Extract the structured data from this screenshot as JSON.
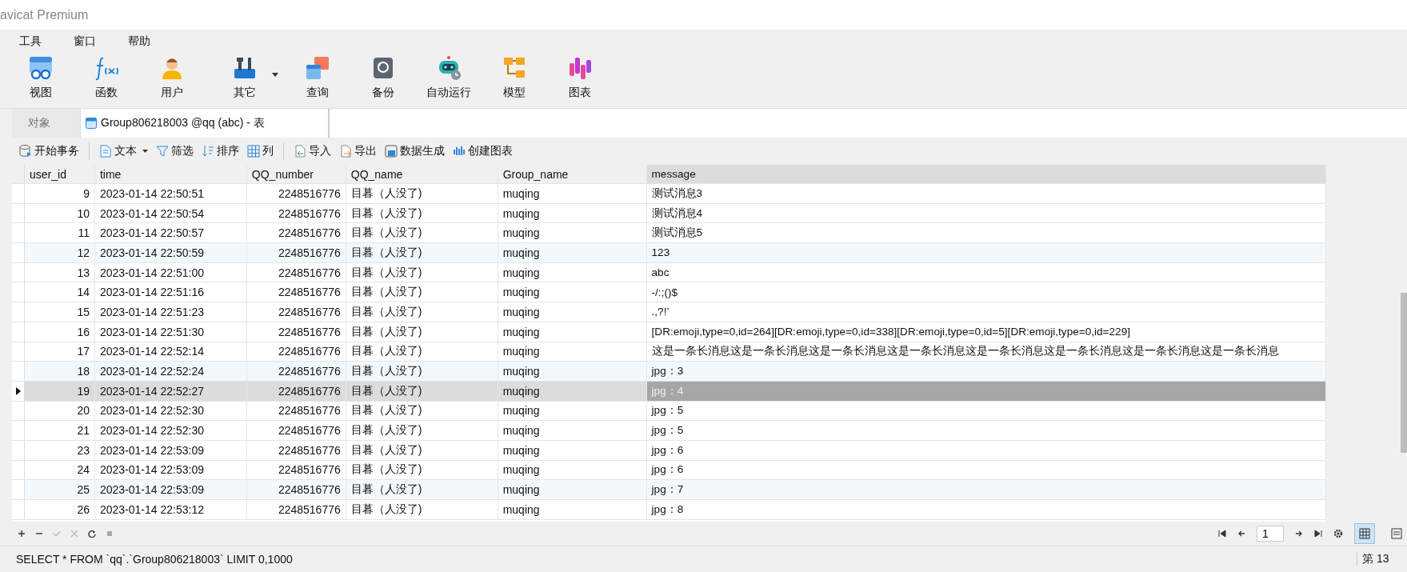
{
  "window": {
    "title": "avicat Premium"
  },
  "menu": [
    "工具",
    "窗口",
    "帮助"
  ],
  "toolbar": [
    {
      "label": "视图",
      "dropdown": false
    },
    {
      "label": "函数",
      "dropdown": false
    },
    {
      "label": "用户",
      "dropdown": false
    },
    {
      "label": "其它",
      "dropdown": true
    },
    {
      "label": "查询",
      "dropdown": false
    },
    {
      "label": "备份",
      "dropdown": false
    },
    {
      "label": "自动运行",
      "dropdown": false
    },
    {
      "label": "模型",
      "dropdown": false
    },
    {
      "label": "图表",
      "dropdown": false
    }
  ],
  "tabs": [
    {
      "label": "对象",
      "selected": false
    },
    {
      "label": "Group806218003 @qq (abc) - 表",
      "selected": true
    }
  ],
  "actions": [
    [
      {
        "label": "开始事务",
        "dropdown": false
      }
    ],
    [
      {
        "label": "文本",
        "dropdown": true
      },
      {
        "label": "筛选",
        "dropdown": false
      },
      {
        "label": "排序",
        "dropdown": false
      },
      {
        "label": "列",
        "dropdown": false
      }
    ],
    [
      {
        "label": "导入",
        "dropdown": false
      },
      {
        "label": "导出",
        "dropdown": false
      },
      {
        "label": "数据生成",
        "dropdown": false
      },
      {
        "label": "创建图表",
        "dropdown": false
      }
    ]
  ],
  "table": {
    "columns": [
      "user_id",
      "time",
      "QQ_number",
      "QQ_name",
      "Group_name",
      "message"
    ],
    "rows": [
      {
        "cells": [
          "9",
          "2023-01-14 22:50:51",
          "2248516776",
          "目暮（人没了)",
          "muqing",
          "测试消息3"
        ],
        "selected": false,
        "tinted": false
      },
      {
        "cells": [
          "10",
          "2023-01-14 22:50:54",
          "2248516776",
          "目暮（人没了)",
          "muqing",
          "测试消息4"
        ],
        "selected": false,
        "tinted": false
      },
      {
        "cells": [
          "11",
          "2023-01-14 22:50:57",
          "2248516776",
          "目暮（人没了)",
          "muqing",
          "测试消息5"
        ],
        "selected": false,
        "tinted": false
      },
      {
        "cells": [
          "12",
          "2023-01-14 22:50:59",
          "2248516776",
          "目暮（人没了)",
          "muqing",
          "123"
        ],
        "selected": false,
        "tinted": true
      },
      {
        "cells": [
          "13",
          "2023-01-14 22:51:00",
          "2248516776",
          "目暮（人没了)",
          "muqing",
          "abc"
        ],
        "selected": false,
        "tinted": false
      },
      {
        "cells": [
          "14",
          "2023-01-14 22:51:16",
          "2248516776",
          "目暮（人没了)",
          "muqing",
          "-/:;()$"
        ],
        "selected": false,
        "tinted": false
      },
      {
        "cells": [
          "15",
          "2023-01-14 22:51:23",
          "2248516776",
          "目暮（人没了)",
          "muqing",
          ".,?!’"
        ],
        "selected": false,
        "tinted": false
      },
      {
        "cells": [
          "16",
          "2023-01-14 22:51:30",
          "2248516776",
          "目暮（人没了)",
          "muqing",
          "[DR:emoji,type=0,id=264][DR:emoji,type=0,id=338][DR:emoji,type=0,id=5][DR:emoji,type=0,id=229]"
        ],
        "selected": false,
        "tinted": false
      },
      {
        "cells": [
          "17",
          "2023-01-14 22:52:14",
          "2248516776",
          "目暮（人没了)",
          "muqing",
          "这是一条长消息这是一条长消息这是一条长消息这是一条长消息这是一条长消息这是一条长消息这是一条长消息这是一条长消息"
        ],
        "selected": false,
        "tinted": false
      },
      {
        "cells": [
          "18",
          "2023-01-14 22:52:24",
          "2248516776",
          "目暮（人没了)",
          "muqing",
          "jpg：3"
        ],
        "selected": false,
        "tinted": true
      },
      {
        "cells": [
          "19",
          "2023-01-14 22:52:27",
          "2248516776",
          "目暮（人没了)",
          "muqing",
          "jpg：4"
        ],
        "selected": true,
        "tinted": false
      },
      {
        "cells": [
          "20",
          "2023-01-14 22:52:30",
          "2248516776",
          "目暮（人没了)",
          "muqing",
          "jpg：5"
        ],
        "selected": false,
        "tinted": false
      },
      {
        "cells": [
          "21",
          "2023-01-14 22:52:30",
          "2248516776",
          "目暮（人没了)",
          "muqing",
          "jpg：5"
        ],
        "selected": false,
        "tinted": false
      },
      {
        "cells": [
          "23",
          "2023-01-14 22:53:09",
          "2248516776",
          "目暮（人没了)",
          "muqing",
          "jpg：6"
        ],
        "selected": false,
        "tinted": false
      },
      {
        "cells": [
          "24",
          "2023-01-14 22:53:09",
          "2248516776",
          "目暮（人没了)",
          "muqing",
          "jpg：6"
        ],
        "selected": false,
        "tinted": false
      },
      {
        "cells": [
          "25",
          "2023-01-14 22:53:09",
          "2248516776",
          "目暮（人没了)",
          "muqing",
          "jpg：7"
        ],
        "selected": false,
        "tinted": true
      },
      {
        "cells": [
          "26",
          "2023-01-14 22:53:12",
          "2248516776",
          "目暮（人没了)",
          "muqing",
          "jpg：8"
        ],
        "selected": false,
        "tinted": false
      }
    ]
  },
  "pager": {
    "page": "1"
  },
  "status_bar": {
    "sql": "SELECT * FROM `qq`.`Group806218003` LIMIT 0,1000",
    "record": "第 13"
  }
}
